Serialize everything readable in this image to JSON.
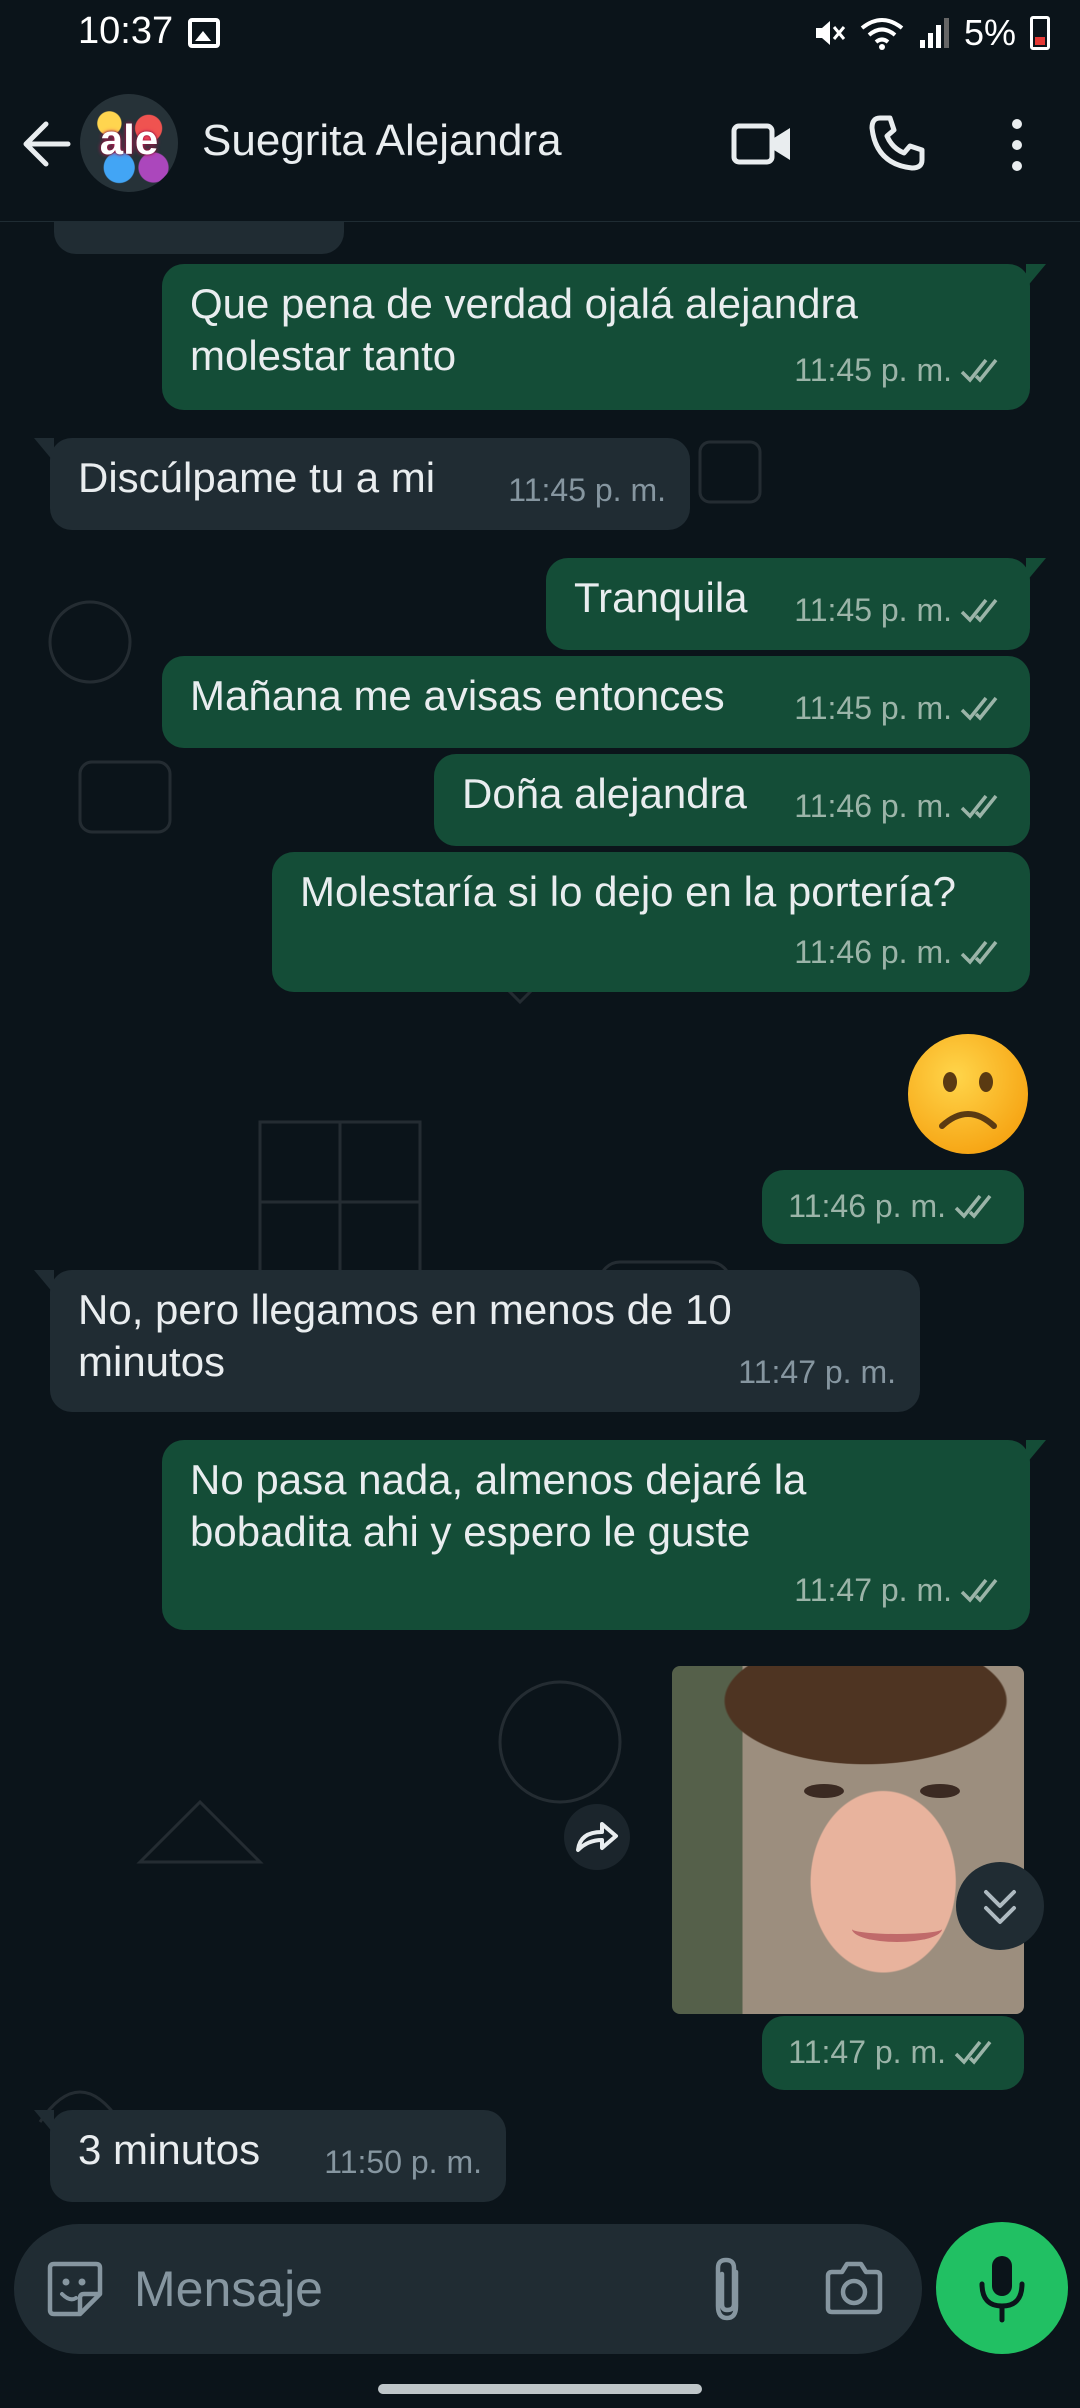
{
  "status_bar": {
    "time": "10:37",
    "battery": "5%",
    "icons": [
      "photo-icon",
      "mute-icon",
      "wifi-icon",
      "signal-icon",
      "battery-low-icon"
    ]
  },
  "header": {
    "contact_name": "Suegrita Alejandra",
    "avatar_text": "ale",
    "icons": [
      "back-arrow-icon",
      "video-call-icon",
      "voice-call-icon",
      "more-options-icon"
    ]
  },
  "messages": [
    {
      "direction": "out",
      "text_lines": [
        "Que pena de verdad ojalá alejandra",
        "molestar tanto"
      ],
      "time": "11:45 p. m.",
      "status": "read"
    },
    {
      "direction": "in",
      "text_lines": [
        "Discúlpame tu a mi"
      ],
      "time": "11:45 p. m."
    },
    {
      "direction": "out",
      "text_lines": [
        "Tranquila"
      ],
      "time": "11:45 p. m.",
      "status": "read"
    },
    {
      "direction": "out",
      "text_lines": [
        "Mañana me avisas entonces"
      ],
      "time": "11:45 p. m.",
      "status": "read"
    },
    {
      "direction": "out",
      "text_lines": [
        "Doña alejandra"
      ],
      "time": "11:46 p. m.",
      "status": "read"
    },
    {
      "direction": "out",
      "text_lines": [
        "Molestaría si lo dejo en la portería?"
      ],
      "time": "11:46 p. m.",
      "status": "read"
    },
    {
      "direction": "out",
      "type": "emoji",
      "emoji": "sad-face-emoji",
      "time": "11:46 p. m.",
      "status": "read"
    },
    {
      "direction": "in",
      "text_lines": [
        "No, pero llegamos en menos de 10",
        "minutos"
      ],
      "time": "11:47 p. m."
    },
    {
      "direction": "out",
      "text_lines": [
        "No pasa nada, almenos dejaré la",
        "bobadita ahi y espero le guste"
      ],
      "time": "11:47 p. m.",
      "status": "read"
    },
    {
      "direction": "out",
      "type": "photo",
      "time": "11:47 p. m.",
      "status": "read"
    },
    {
      "direction": "in",
      "text_lines": [
        "3 minutos"
      ],
      "time": "11:50 p. m."
    }
  ],
  "composer": {
    "placeholder": "Mensaje",
    "icons": [
      "sticker-icon",
      "attach-icon",
      "camera-icon",
      "mic-icon"
    ]
  },
  "colors": {
    "background": "#0b141a",
    "outgoing_bubble": "#144d37",
    "incoming_bubble": "#202c33",
    "read_ticks": "#9bb4a8",
    "mic_button": "#21c063"
  }
}
